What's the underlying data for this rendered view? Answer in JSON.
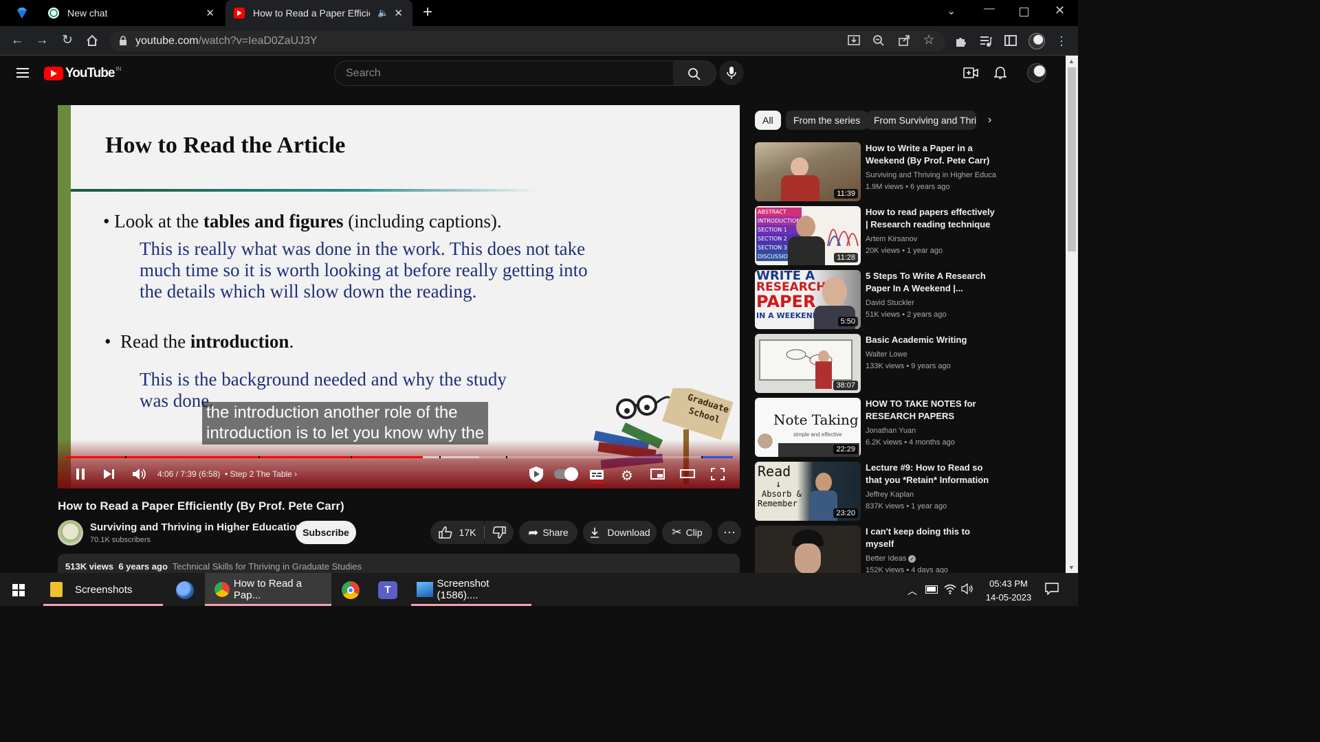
{
  "browser": {
    "tabs": [
      {
        "title": "New chat",
        "active": false
      },
      {
        "title": "How to Read a Paper Efficien",
        "active": true
      }
    ],
    "new_tab_label": "+",
    "url_host": "youtube.com",
    "url_path": "/watch?v=IeaD0ZaUJ3Y"
  },
  "youtube": {
    "logo_text": "YouTube",
    "logo_region": "IN",
    "search_placeholder": "Search"
  },
  "player": {
    "slide": {
      "heading": "How to Read the Article",
      "bullet1_pre": "Look at the ",
      "bullet1_bold": "tables and figures",
      "bullet1_post": " (including  captions).",
      "para1_line1": "This is really what was done in the work. This does not take",
      "para1_line2": "much time so it is worth looking at before really getting into",
      "para1_line3": "the details which will slow down the reading.",
      "bullet2_pre": "Read the ",
      "bullet2_bold": "introduction",
      "bullet2_post": ".",
      "para2_line1": "This is the background needed and why the study",
      "para2_line2": "was done.",
      "sign_line1": "Graduate",
      "sign_line2": "School"
    },
    "caption_line1": "the introduction another role of the",
    "caption_line2": "introduction is to let you know why the",
    "time": "4:06 / 7:39 (6:58)",
    "chapter": "Step 2 The Table",
    "progress_fraction": 0.535,
    "buffer_fraction": 0.62
  },
  "video": {
    "title": "How to Read a Paper Efficiently (By Prof. Pete Carr)",
    "channel": "Surviving and Thriving in Higher Education",
    "subscribers": "70.1K subscribers",
    "subscribe_label": "Subscribe",
    "likes": "17K",
    "share_label": "Share",
    "download_label": "Download",
    "clip_label": "Clip",
    "views": "513K views",
    "age": "6 years ago",
    "tag": "Technical Skills for Thriving in Graduate Studies"
  },
  "chips": [
    "All",
    "From the series",
    "From Surviving and Thriv"
  ],
  "recommendations": [
    {
      "title": "How to Write a Paper in a Weekend (By Prof. Pete Carr)",
      "channel": "Surviving and Thriving in Higher Educa...",
      "views": "1.9M views",
      "age": "6 years ago",
      "duration": "11:39"
    },
    {
      "title": "How to read papers effectively | Research reading technique",
      "channel": "Artem Kirsanov",
      "views": "20K views",
      "age": "1 year ago",
      "duration": "11:28"
    },
    {
      "title": "5 Steps To Write A Research Paper In A Weekend |...",
      "channel": "David Stuckler",
      "views": "51K views",
      "age": "2 years ago",
      "duration": "5:50"
    },
    {
      "title": "Basic Academic Writing",
      "channel": "Walter Lowe",
      "views": "133K views",
      "age": "9 years ago",
      "duration": "38:07"
    },
    {
      "title": "HOW TO TAKE NOTES for RESEARCH PAPERS",
      "channel": "Jonathan Yuan",
      "views": "6.2K views",
      "age": "4 months ago",
      "duration": "22:29"
    },
    {
      "title": "Lecture #9: How to Read so that you *Retain* Information",
      "channel": "Jeffrey Kaplan",
      "views": "837K views",
      "age": "1 year ago",
      "duration": "23:20"
    },
    {
      "title": "I can't keep doing this to myself",
      "channel": "Better Ideas",
      "views": "152K views",
      "age": "4 days ago",
      "duration": ""
    }
  ],
  "thumb_text": {
    "t2_words": [
      "ABSTRACT",
      "INTRODUCTION",
      "SECTION 1",
      "SECTION 2",
      "SECTION 3",
      "DISCUSSION"
    ],
    "t3_line1": "WRITE A",
    "t3_line2": "RESEARCH",
    "t3_line3": "PAPER",
    "t3_line4": "IN A WEEKEND",
    "t5_line1": "Note Taking",
    "t5_line2": "simple and effective",
    "t6_line1": "Read",
    "t6_line2": "Absorb &",
    "t6_line3": "Remember"
  },
  "taskbar": {
    "items": [
      "Screenshots",
      "How to Read a Pap...",
      "Screenshot (1586)...."
    ],
    "time": "05:43 PM",
    "date": "14-05-2023"
  },
  "colors": {
    "yt_red": "#ff0000",
    "progress_red": "#f00",
    "subscribe_bg": "#f1f1f1"
  }
}
